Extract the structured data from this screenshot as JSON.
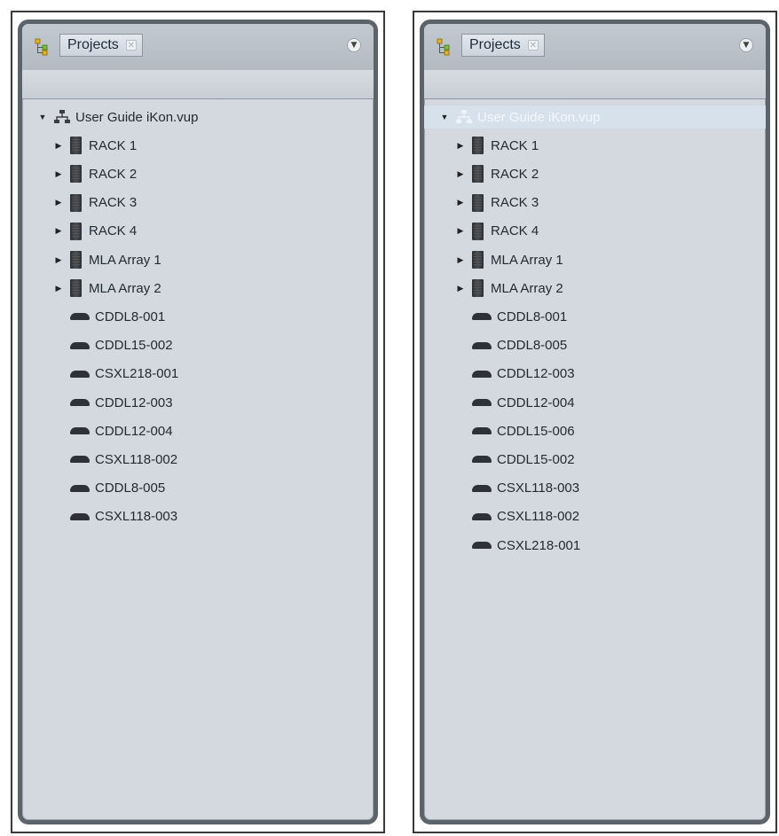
{
  "panels": [
    {
      "tab_label": "Projects",
      "root_label": "User Guide iKon.vup",
      "racks": [
        "RACK 1",
        "RACK 2",
        "RACK 3",
        "RACK 4",
        "MLA Array 1",
        "MLA Array 2"
      ],
      "devices": [
        "CDDL8-001",
        "CDDL15-002",
        "CSXL218-001",
        "CDDL12-003",
        "CDDL12-004",
        "CSXL118-002",
        "CDDL8-005",
        "CSXL118-003"
      ]
    },
    {
      "tab_label": "Projects",
      "root_label": "User Guide iKon.vup",
      "root_selected": true,
      "racks": [
        "RACK 1",
        "RACK 2",
        "RACK 3",
        "RACK 4",
        "MLA Array 1",
        "MLA Array 2"
      ],
      "devices": [
        "CDDL8-001",
        "CDDL8-005",
        "CDDL12-003",
        "CDDL12-004",
        "CDDL15-006",
        "CDDL15-002",
        "CSXL118-003",
        "CSXL118-002",
        "CSXL218-001"
      ]
    }
  ],
  "icons": {
    "project": "project-tree-icon",
    "close": "close-icon",
    "menu": "view-menu-icon",
    "rack": "rack-icon",
    "speaker": "speaker-icon",
    "network": "network-icon"
  }
}
